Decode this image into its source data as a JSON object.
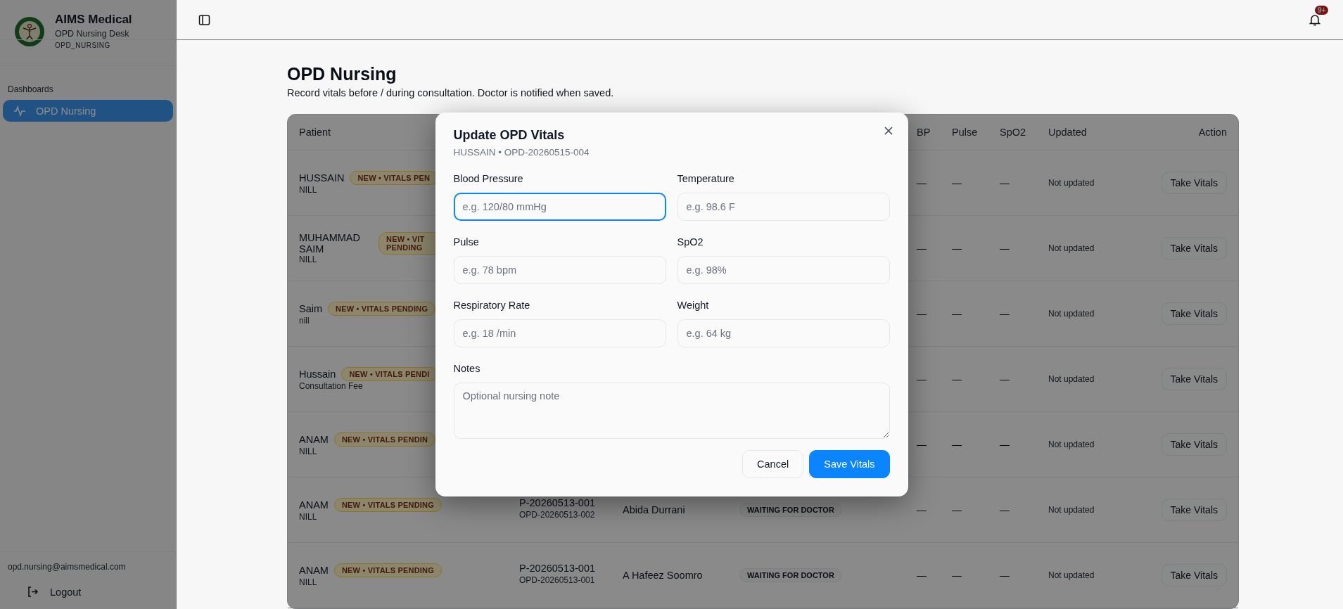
{
  "sidebar": {
    "brand": {
      "title": "AIMS Medical",
      "subtitle": "OPD Nursing Desk",
      "role": "OPD_NURSING"
    },
    "section": "Dashboards",
    "items": [
      {
        "label": "OPD Nursing",
        "selected": true
      }
    ],
    "email": "opd.nursing@aimsmedical.com",
    "logout": "Logout"
  },
  "header": {
    "notification_badge": "9+"
  },
  "page": {
    "title": "OPD Nursing",
    "subtitle": "Record vitals before / during consultation. Doctor is notified when saved."
  },
  "table": {
    "columns": [
      "Patient",
      "BP",
      "Pulse",
      "SpO2",
      "Updated",
      "Action"
    ],
    "rows": [
      {
        "patient": "HUSSAIN",
        "note": "NILL",
        "badge": "NEW • VITALS PEN",
        "bp": "—",
        "pulse": "—",
        "spo2": "—",
        "updated": "Not updated",
        "action": "Take Vitals"
      },
      {
        "patient": "MUHAMMAD SAIM",
        "note": "NILL",
        "badge": "NEW • VIT PENDING",
        "bp": "—",
        "pulse": "—",
        "spo2": "—",
        "updated": "Not updated",
        "action": "Take Vitals"
      },
      {
        "patient": "Saim",
        "note": "nill",
        "badge": "NEW • VITALS PENDING",
        "bp": "—",
        "pulse": "—",
        "spo2": "—",
        "updated": "Not updated",
        "action": "Take Vitals"
      },
      {
        "patient": "Hussain",
        "note": "Consultation Fee",
        "badge": "NEW • VITALS PENDI",
        "bp": "—",
        "pulse": "—",
        "spo2": "—",
        "updated": "Not updated",
        "action": "Take Vitals"
      },
      {
        "patient": "ANAM",
        "note": "NILL",
        "badge": "NEW • VITALS PENDIN",
        "bp": "—",
        "pulse": "—",
        "spo2": "—",
        "updated": "Not updated",
        "action": "Take Vitals"
      },
      {
        "patient": "ANAM",
        "note": "NILL",
        "badge": "NEW • VITALS PENDING",
        "patient_id": "P-20260513-001",
        "visit_id": "OPD-20260513-002",
        "doctor": "Abida Durrani",
        "status": "WAITING FOR DOCTOR",
        "bp": "—",
        "pulse": "—",
        "spo2": "—",
        "updated": "Not updated",
        "action": "Take Vitals"
      },
      {
        "patient": "ANAM",
        "note": "NILL",
        "badge": "NEW • VITALS PENDING",
        "patient_id": "P-20260513-001",
        "visit_id": "OPD-20260513-001",
        "doctor": "A Hafeez Soomro",
        "status": "WAITING FOR DOCTOR",
        "bp": "—",
        "pulse": "—",
        "spo2": "—",
        "updated": "Not updated",
        "action": "Take Vitals"
      }
    ]
  },
  "modal": {
    "title": "Update OPD Vitals",
    "subtitle": "HUSSAIN • OPD-20260515-004",
    "fields": [
      {
        "label": "Blood Pressure",
        "placeholder": "e.g. 120/80 mmHg",
        "kind": "input",
        "focused": true
      },
      {
        "label": "Temperature",
        "placeholder": "e.g. 98.6 F",
        "kind": "input",
        "focused": false
      },
      {
        "label": "Pulse",
        "placeholder": "e.g. 78 bpm",
        "kind": "input",
        "focused": false
      },
      {
        "label": "SpO2",
        "placeholder": "e.g. 98%",
        "kind": "input",
        "focused": false
      },
      {
        "label": "Respiratory Rate",
        "placeholder": "e.g. 18 /min",
        "kind": "input",
        "focused": false
      },
      {
        "label": "Weight",
        "placeholder": "e.g. 64 kg",
        "kind": "input",
        "focused": false
      },
      {
        "label": "Notes",
        "placeholder": "Optional nursing note",
        "kind": "textarea",
        "focused": false
      }
    ],
    "buttons": [
      {
        "label": "Cancel",
        "kind": "secondary"
      },
      {
        "label": "Save Vitals",
        "kind": "primary"
      }
    ]
  }
}
